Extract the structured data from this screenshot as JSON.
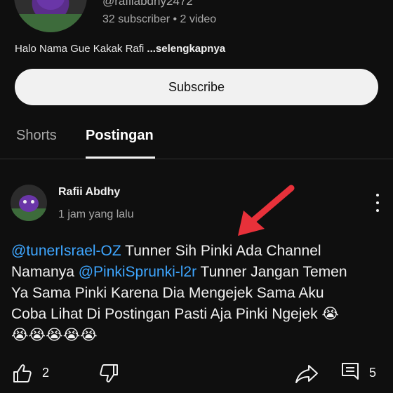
{
  "channel": {
    "handle": "@rafiiabdhy2472",
    "stats": "32 subscriber • 2 video",
    "description": "Halo Nama Gue Kakak Rafi ",
    "description_more": "...selengkapnya",
    "subscribe_label": "Subscribe"
  },
  "tabs": [
    {
      "label": "Shorts",
      "active": false
    },
    {
      "label": "Postingan",
      "active": true
    }
  ],
  "post": {
    "author": "Rafii Abdhy",
    "time": "1 jam yang lalu",
    "text": {
      "mention1": "@tunerIsrael-OZ",
      "seg1": " Tunner Sih Pinki Ada Channel",
      "seg2": "Namanya ",
      "mention2": "@PinkiSprunki-l2r",
      "seg3": " Tunner Jangan Temen",
      "seg4": "Ya Sama Pinki Karena Dia Mengejek Sama Aku",
      "seg5": "Coba Lihat Di Postingan Pasti Aja Pinki Ngejek 😭",
      "seg6": "😭😭😭😭😭"
    },
    "like_count": "2",
    "comment_count": "5"
  },
  "colors": {
    "background": "#0f0f0f",
    "mention": "#3ea6ff",
    "annotation_arrow": "#e8313a"
  },
  "icons": [
    "like-icon",
    "dislike-icon",
    "share-icon",
    "comment-icon",
    "more-vert-icon"
  ]
}
